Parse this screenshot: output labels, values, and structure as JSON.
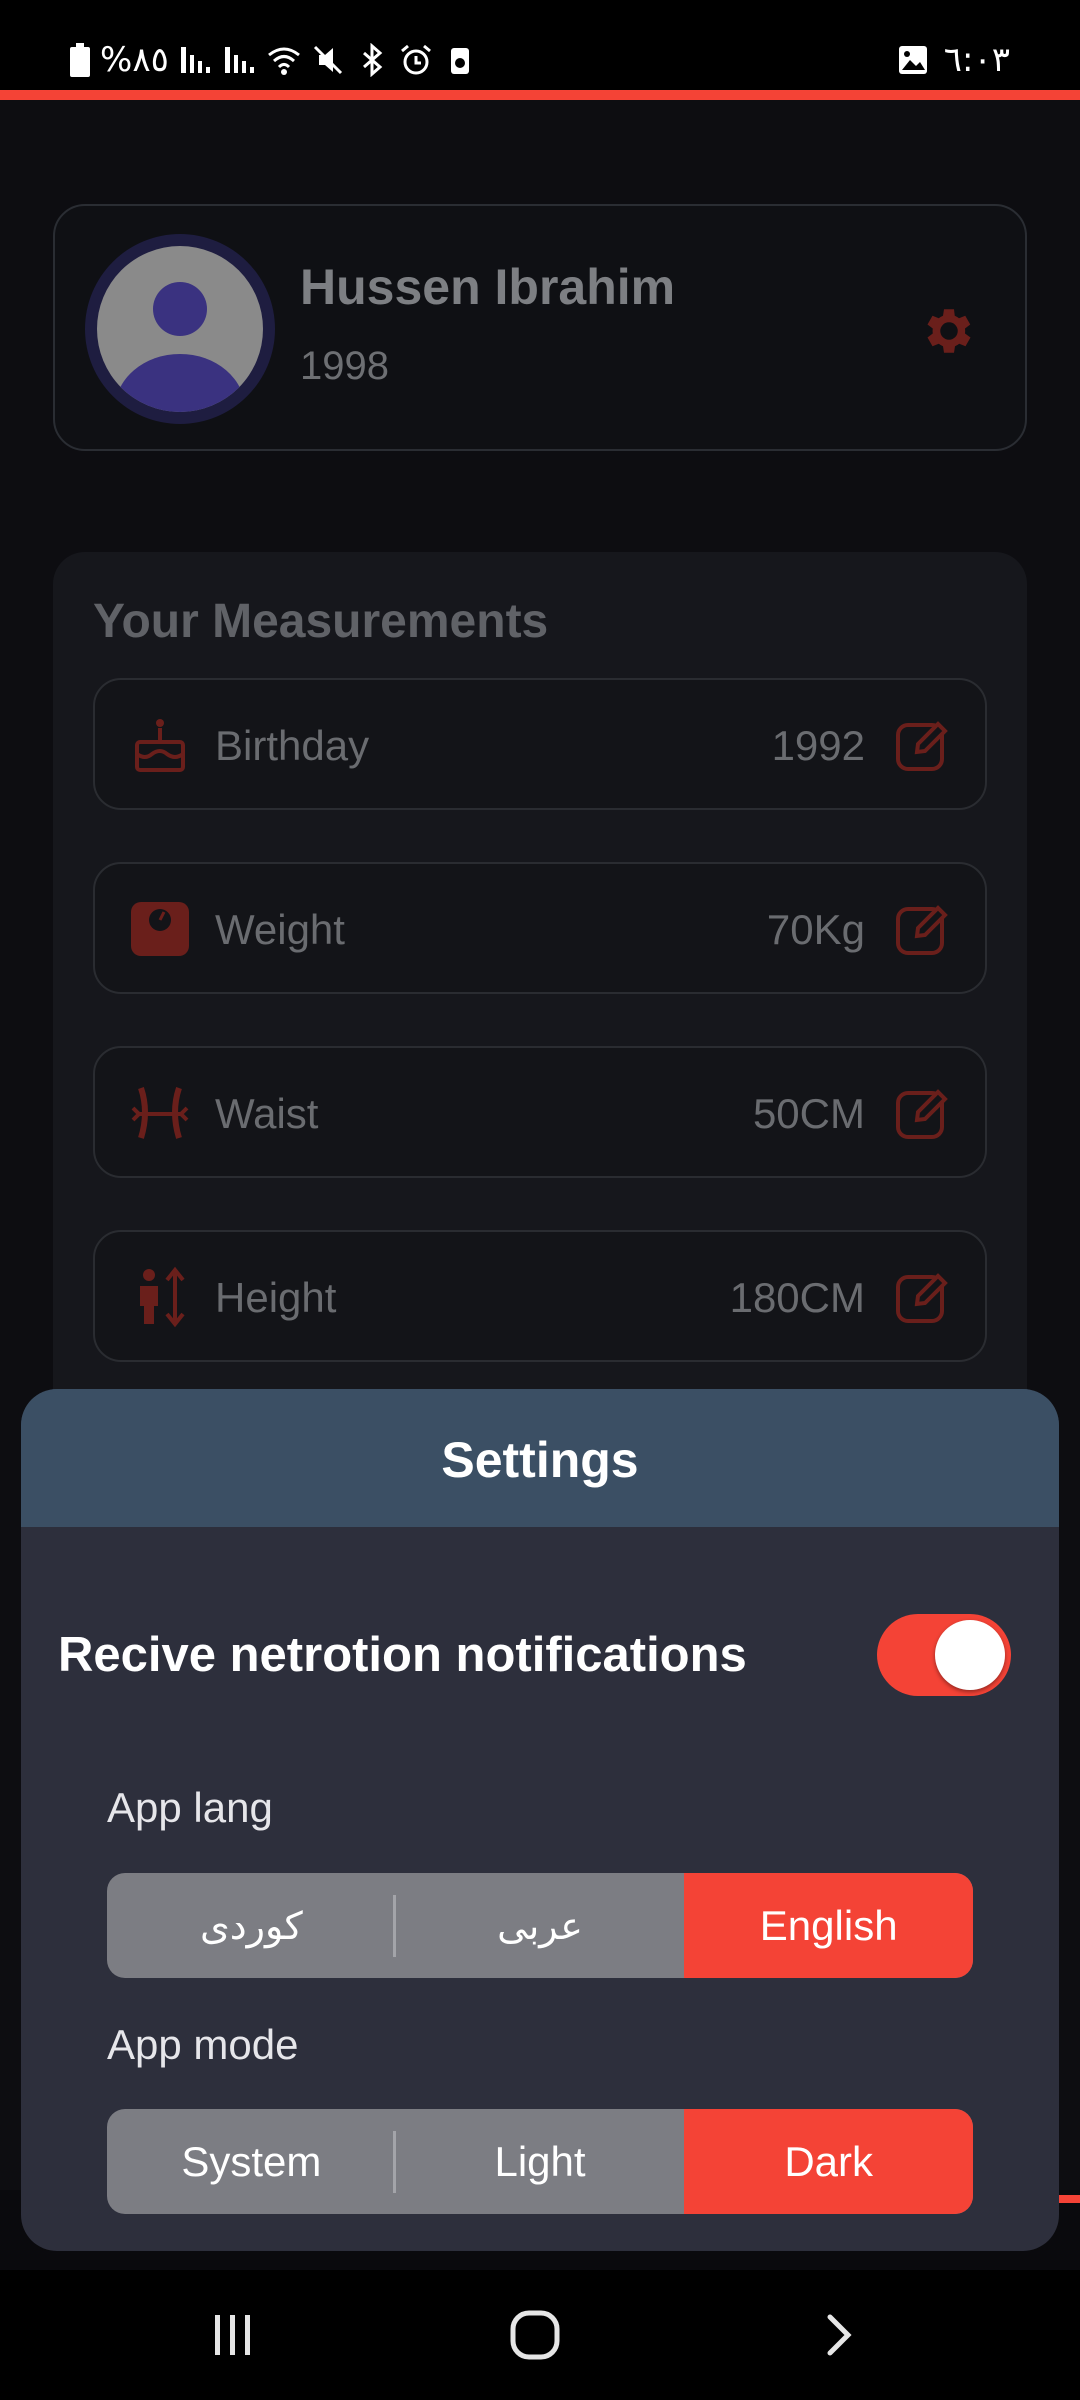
{
  "status_bar": {
    "battery": "%٨٥",
    "time": "٦:٠٣",
    "icons": [
      "battery-icon",
      "signal-icon",
      "signal-icon",
      "wifi-icon",
      "mute-icon",
      "bluetooth-icon",
      "alarm-icon",
      "saver-icon",
      "gallery-icon"
    ]
  },
  "profile": {
    "name": "Hussen Ibrahim",
    "year": "1998",
    "icons": [
      "avatar-icon",
      "gear-icon"
    ]
  },
  "measurements": {
    "title": "Your Measurements",
    "items": [
      {
        "label": "Birthday",
        "value": "1992",
        "icon": "cake-icon"
      },
      {
        "label": "Weight",
        "value": "70Kg",
        "icon": "scale-icon"
      },
      {
        "label": "Waist",
        "value": "50CM",
        "icon": "waist-icon"
      },
      {
        "label": "Height",
        "value": "180CM",
        "icon": "height-icon"
      }
    ]
  },
  "settings": {
    "title": "Settings",
    "notifications_label": "Recive netrotion notifications",
    "notifications_enabled": true,
    "lang_label": "App lang",
    "lang_options": [
      "کوردی",
      "عربی",
      "English"
    ],
    "lang_selected": "English",
    "mode_label": "App mode",
    "mode_options": [
      "System",
      "Light",
      "Dark"
    ],
    "mode_selected": "Dark"
  },
  "colors": {
    "accent": "#f44336",
    "sheet_bg": "#2d2f3c",
    "sheet_header": "#3b4f64",
    "app_bg": "#0d0d11"
  },
  "nav_bar": {
    "icons": [
      "recent-apps-icon",
      "home-icon",
      "back-icon"
    ]
  }
}
